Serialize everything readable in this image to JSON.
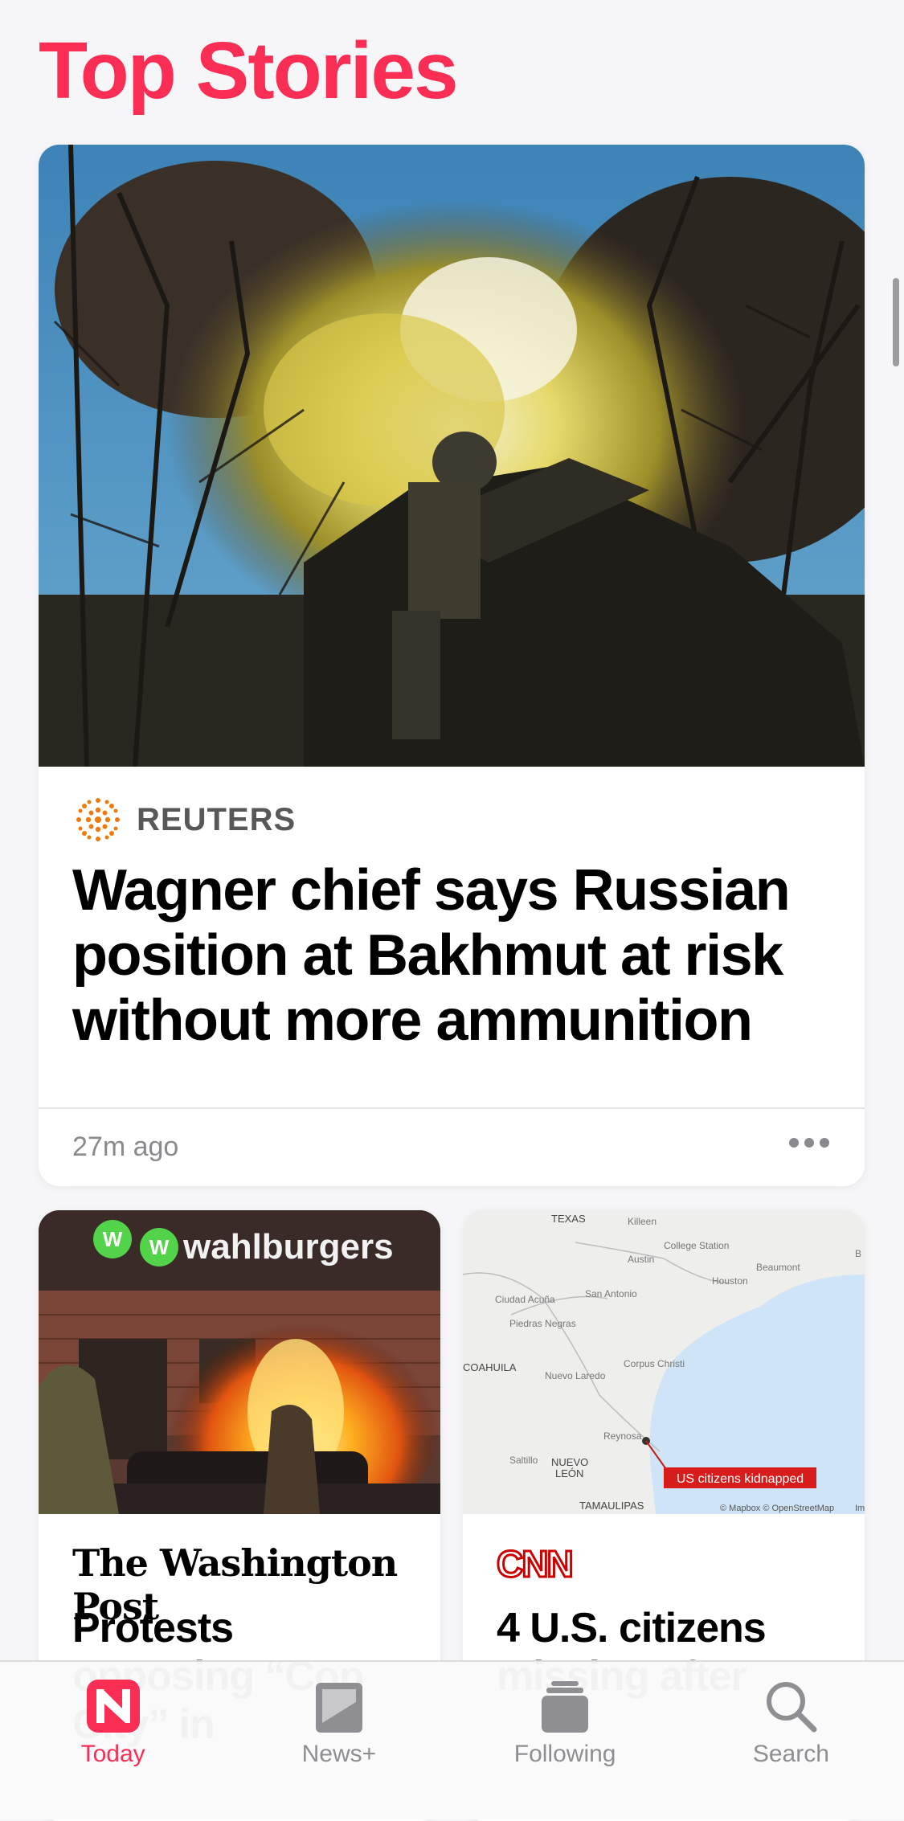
{
  "page": {
    "title": "Top Stories"
  },
  "hero": {
    "source": "REUTERS",
    "headline": "Wagner chief says Russian position at Bakhmut at risk without more ammunition",
    "time": "27m ago"
  },
  "story2": {
    "source": "The Washington Post",
    "sign_text": "wahlburgers",
    "sign_logo": "W",
    "headline": "Protests opposing “Cop City” in"
  },
  "story3": {
    "source": "CNN",
    "headline": "4 U.S. citizens missing after",
    "map": {
      "labels": [
        "TEXAS",
        "Killeen",
        "College Station",
        "Austin",
        "Beaumont",
        "Houston",
        "Ciudad Acuña",
        "San Antonio",
        "Piedras Negras",
        "Corpus Christi",
        "COAHUILA",
        "Nuevo Laredo",
        "Reynosa",
        "Saltillo",
        "NUEVO",
        "LEÓN",
        "TAMAULIPAS",
        "B"
      ],
      "callout": "US citizens kidnapped",
      "attribution": "© Mapbox © OpenStreetMap",
      "attribution_extra": "Im"
    }
  },
  "tabbar": {
    "items": [
      {
        "label": "Today",
        "icon": "news-icon",
        "active": true
      },
      {
        "label": "News+",
        "icon": "news-plus-icon",
        "active": false
      },
      {
        "label": "Following",
        "icon": "following-icon",
        "active": false
      },
      {
        "label": "Search",
        "icon": "search-icon",
        "active": false
      }
    ]
  },
  "colors": {
    "accent": "#fa2d55",
    "cnn": "#cc0000",
    "reuters": "#f07a10",
    "water": "#cfe4f6",
    "land": "#eeeeec"
  }
}
